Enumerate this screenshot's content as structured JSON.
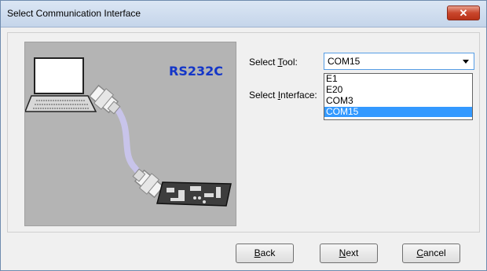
{
  "window": {
    "title": "Select Communication Interface",
    "close_glyph": "✕"
  },
  "illustration": {
    "label": "RS232C",
    "label_color": "#1436c8",
    "laptop_icon": "laptop-icon",
    "board_icon": "circuit-board-icon"
  },
  "form": {
    "tool_label_pre": "Select ",
    "tool_label_key": "T",
    "tool_label_post": "ool:",
    "interface_label_pre": "Select ",
    "interface_label_key": "I",
    "interface_label_post": "nterface:",
    "tool_value": "COM15",
    "options": [
      "E1",
      "E20",
      "COM3",
      "COM15"
    ],
    "selected_option": "COM15"
  },
  "buttons": {
    "back_key": "B",
    "back_rest": "ack",
    "next_key": "N",
    "next_rest": "ext",
    "cancel_key": "C",
    "cancel_rest": "ancel"
  },
  "colors": {
    "selection": "#3399ff",
    "close": "#c9462c"
  }
}
